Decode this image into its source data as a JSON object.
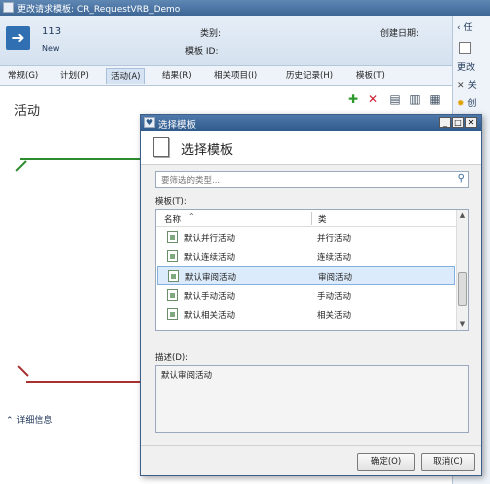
{
  "background_window": {
    "title": "更改请求模板: CR_RequestVRB_Demo",
    "header": {
      "id": "113",
      "status": "New",
      "category_label": "类别:",
      "template_id_label": "模板 ID:",
      "created_date_label": "创建日期:"
    },
    "tabs": [
      {
        "label": "常规(G)"
      },
      {
        "label": "计划(P)"
      },
      {
        "label": "活动(A)"
      },
      {
        "label": "结果(R)"
      },
      {
        "label": "相关项目(I)"
      },
      {
        "label": "历史记录(H)"
      },
      {
        "label": "模板(T)"
      }
    ],
    "active_tab": "活动(A)",
    "section_title": "活动",
    "details_link": "详细信息",
    "right_panel": {
      "items": [
        {
          "label": "任"
        },
        {
          "label": "更改"
        },
        {
          "label": "关"
        },
        {
          "label": "创"
        }
      ]
    }
  },
  "dialog": {
    "title": "选择模板",
    "heading": "选择模板",
    "filter_placeholder": "要筛选的类型...",
    "templates_label": "模板(T):",
    "columns": {
      "name": "名称",
      "category": "类"
    },
    "rows": [
      {
        "name": "默认并行活动",
        "category": "并行活动",
        "selected": false
      },
      {
        "name": "默认连续活动",
        "category": "连续活动",
        "selected": false
      },
      {
        "name": "默认审阅活动",
        "category": "审阅活动",
        "selected": true
      },
      {
        "name": "默认手动活动",
        "category": "手动活动",
        "selected": false
      },
      {
        "name": "默认相关活动",
        "category": "相关活动",
        "selected": false
      }
    ],
    "description_label": "描述(D):",
    "description": "默认审阅活动",
    "ok_label": "确定(O)",
    "cancel_label": "取消(C)"
  },
  "colors": {
    "titlebar": "#3f6796",
    "selected_row": "#dcebfb",
    "green_line": "#2e8b2e",
    "red_line": "#a83232"
  }
}
